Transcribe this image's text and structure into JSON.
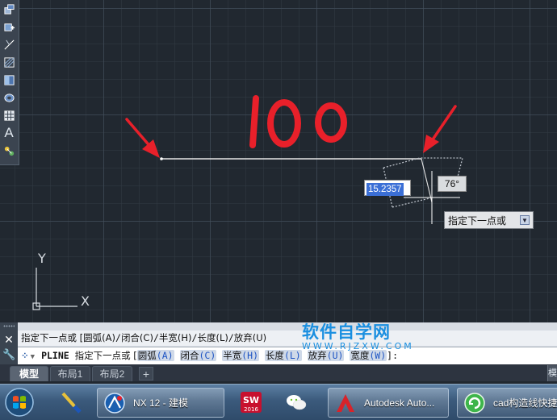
{
  "canvas": {
    "handwritten_annotation": "100",
    "dynamic_input_value": "15.2357",
    "angle_value": "76°",
    "prompt_tooltip": "指定下一点或",
    "ucs_x_label": "X",
    "ucs_y_label": "Y"
  },
  "toolbar": {
    "icons": [
      "insert-block-icon",
      "create-block-icon",
      "point-icon",
      "hatch-icon",
      "gradient-icon",
      "region-icon",
      "table-icon",
      "multiline-text-icon",
      "add-selected-icon"
    ]
  },
  "command": {
    "history_prefix": "指定下一点或 [",
    "history_opt1": "圆弧(A)",
    "history_opt2": "闭合(C)",
    "history_opt3": "半宽(H)",
    "history_opt4": "长度(L)",
    "history_opt5": "放弃(U)",
    "input_command": "PLINE",
    "input_prompt": "指定下一点或 [",
    "opt_arc": "圆弧",
    "opt_arc_key": "(A)",
    "opt_close": "闭合",
    "opt_close_key": "(C)",
    "opt_halfwidth": "半宽",
    "opt_halfwidth_key": "(H)",
    "opt_length": "长度",
    "opt_length_key": "(L)",
    "opt_undo": "放弃",
    "opt_undo_key": "(U)",
    "opt_width": "宽度",
    "opt_width_key": "(W)",
    "input_suffix": "]:"
  },
  "watermark": {
    "title": "软件自学网",
    "url": "WWW.RJZXW.COM"
  },
  "tabs": {
    "model": "模型",
    "layout1": "布局1",
    "layout2": "布局2",
    "add": "+",
    "right_label": "模"
  },
  "taskbar": {
    "items": [
      {
        "label": "NX 12 - 建模"
      },
      {
        "label": "Autodesk Auto..."
      },
      {
        "label": "cad构造线快捷"
      }
    ],
    "solidworks_year": "2016"
  },
  "colors": {
    "canvas_bg": "#212830",
    "annotation_red": "#e8202a",
    "polyline": "#e6e6e6",
    "accent_blue": "#3b6fd6"
  }
}
